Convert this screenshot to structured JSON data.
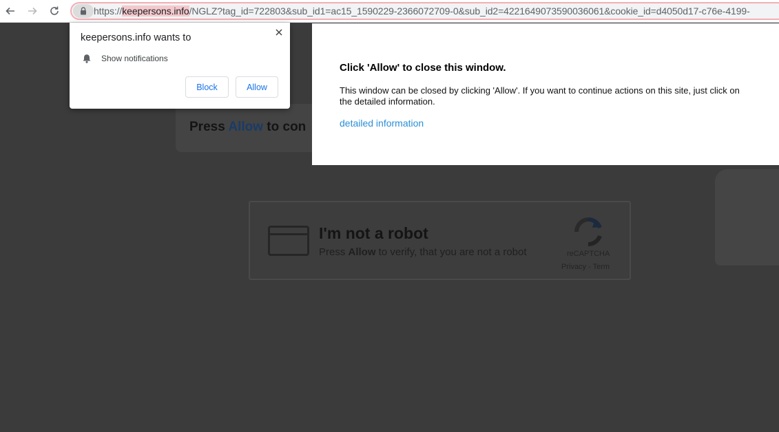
{
  "browser": {
    "url_scheme": "https://",
    "url_host": "keepersons.info",
    "url_rest": "/NGLZ?tag_id=722803&sub_id1=ac15_1590229-2366072709-0&sub_id2=4221649073590036061&cookie_id=d4050d17-c76e-4199-"
  },
  "page": {
    "press_prefix": "Press ",
    "press_highlight": "Allow",
    "press_suffix": " to con",
    "robot_title": "I'm not a robot",
    "robot_sub_prefix": "Press ",
    "robot_sub_bold": "Allow",
    "robot_sub_suffix": " to verify, that you are not a robot",
    "recaptcha_label": "reCAPTCHA",
    "recaptcha_links": "Privacy - Term"
  },
  "overlay": {
    "title": "Click 'Allow' to close this window.",
    "body": "This window can be closed by clicking 'Allow'. If you want to continue actions on this site, just click on the detailed information.",
    "link": "detailed information"
  },
  "prompt": {
    "title": "keepersons.info wants to",
    "permission": "Show notifications",
    "block_label": "Block",
    "allow_label": "Allow"
  },
  "icons": {
    "back": "arrow-left-icon",
    "forward": "arrow-right-icon",
    "reload": "reload-icon",
    "lock": "lock-icon",
    "close": "close-icon",
    "bell": "bell-icon",
    "recaptcha": "recaptcha-icon"
  },
  "colors": {
    "link": "#2a8fd8",
    "prompt_button_text": "#1a73e8",
    "omnibox_focus": "#f4aeb5",
    "page_dim": "#3b3b3b"
  }
}
